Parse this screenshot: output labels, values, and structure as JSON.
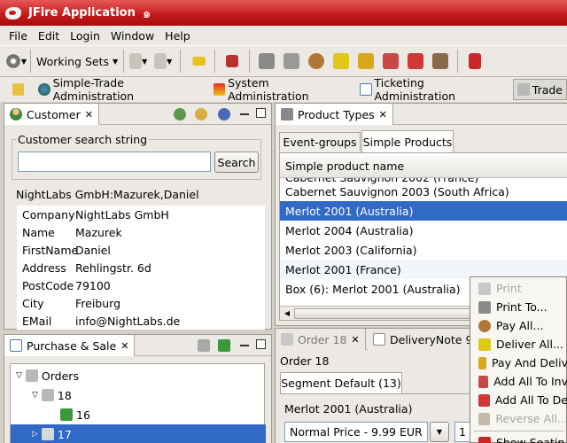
{
  "app": {
    "title": "JFire Application"
  },
  "menu": [
    "File",
    "Edit",
    "Login",
    "Window",
    "Help"
  ],
  "toolbar": {
    "working_sets_label": "Working Sets"
  },
  "perspectives": [
    {
      "label": "Simple-Trade Administration",
      "icon": "globe-icon"
    },
    {
      "label": "System Administration",
      "icon": "superman-icon"
    },
    {
      "label": "Ticketing Administration",
      "icon": "grid-icon"
    },
    {
      "label": "Trade",
      "icon": "cart-icon",
      "active": true
    }
  ],
  "customer_view": {
    "tab_label": "Customer",
    "search_legend": "Customer search string",
    "search_value": "",
    "search_button": "Search",
    "selected_customer": "NightLabs GmbH:Mazurek,Daniel",
    "fields": [
      {
        "key": "Company",
        "value": "NightLabs GmbH"
      },
      {
        "key": "Name",
        "value": "Mazurek"
      },
      {
        "key": "FirstName",
        "value": "Daniel"
      },
      {
        "key": "Address",
        "value": "Rehlingstr. 6d"
      },
      {
        "key": "PostCode",
        "value": "79100"
      },
      {
        "key": "City",
        "value": "Freiburg"
      },
      {
        "key": "EMail",
        "value": "info@NightLabs.de"
      }
    ]
  },
  "product_types_view": {
    "tab_label": "Product Types",
    "sub_tabs": [
      "Event-groups",
      "Simple Products"
    ],
    "column_header": "Simple product name",
    "rows": [
      "Cabernet Sauvignon 2003 (South Africa)",
      "Merlot 2001 (Australia)",
      "Merlot 2004 (Australia)",
      "Merlot 2003 (California)",
      "Merlot 2001 (France)",
      "Box (6): Merlot 2001 (Australia)"
    ],
    "selected_index": 1
  },
  "purchase_sale_view": {
    "tab_label": "Purchase & Sale",
    "tree": [
      {
        "label": "Orders",
        "level": 0
      },
      {
        "label": "18",
        "level": 1
      },
      {
        "label": "16",
        "level": 2
      },
      {
        "label": "17",
        "level": 1
      }
    ]
  },
  "order_view": {
    "tabs": [
      "Order 18",
      "DeliveryNote 9"
    ],
    "heading": "Order 18",
    "segment_tab": "Segment Default (13)",
    "product": "Merlot 2001 (Australia)",
    "price_option": "Normal Price - 9.99 EUR",
    "quantity": "1"
  },
  "context_menu": [
    {
      "label": "Print",
      "disabled": true
    },
    {
      "label": "Print To...",
      "disabled": false
    },
    {
      "label": "Pay All...",
      "disabled": false
    },
    {
      "label": "Deliver All...",
      "disabled": false
    },
    {
      "label": "Pay And Deliv",
      "disabled": false
    },
    {
      "label": "Add All To Inv",
      "disabled": false
    },
    {
      "label": "Add All To De",
      "disabled": false
    },
    {
      "label": "Reverse All...",
      "disabled": true
    },
    {
      "label": "Show Seatin",
      "disabled": false
    }
  ]
}
